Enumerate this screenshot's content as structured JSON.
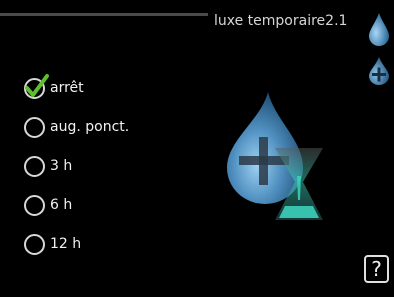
{
  "header": {
    "title": "luxe temporaire",
    "page_number": "2.1"
  },
  "options": [
    {
      "label": "arrêt",
      "selected": true
    },
    {
      "label": "aug. ponct.",
      "selected": false
    },
    {
      "label": "3 h",
      "selected": false
    },
    {
      "label": "6 h",
      "selected": false
    },
    {
      "label": "12 h",
      "selected": false
    }
  ],
  "help": {
    "label": "?"
  },
  "icons": {
    "side_top": "water-drop-icon",
    "side_bottom": "water-drop-plus-icon",
    "hero": "water-drop-hourglass-icon",
    "selected_mark": "checkmark-icon"
  },
  "colors": {
    "accent": "#5fbf2a",
    "drop": "#4f8fbf",
    "hourglass": "#3fd6c0"
  }
}
